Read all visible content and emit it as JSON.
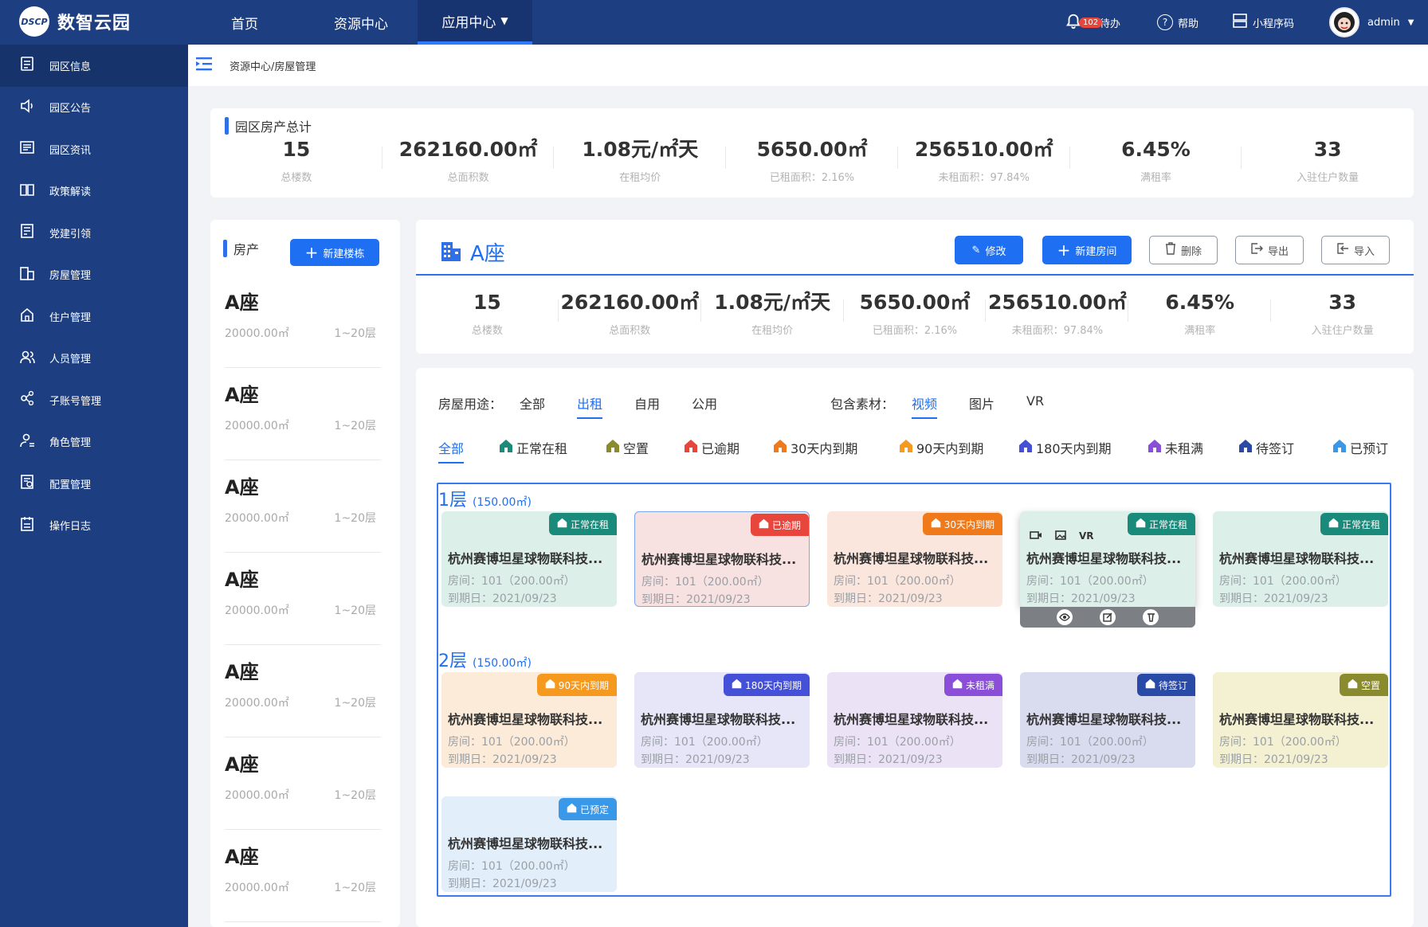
{
  "app": {
    "logo_text": "DSCP",
    "name": "数智云园"
  },
  "topnav": [
    {
      "label": "首页"
    },
    {
      "label": "资源中心"
    },
    {
      "label": "应用中心"
    }
  ],
  "topright": {
    "todo_badge": "102",
    "todo": "待办",
    "help": "帮助",
    "miniapp": "小程序码",
    "user": "admin"
  },
  "sidebar": {
    "items": [
      {
        "label": "园区信息",
        "icon": "document-icon"
      },
      {
        "label": "园区公告",
        "icon": "speaker-icon"
      },
      {
        "label": "园区资讯",
        "icon": "news-icon"
      },
      {
        "label": "政策解读",
        "icon": "book-icon"
      },
      {
        "label": "党建引领",
        "icon": "flag-icon"
      },
      {
        "label": "房屋管理",
        "icon": "building-icon"
      },
      {
        "label": "住户管理",
        "icon": "house-icon"
      },
      {
        "label": "人员管理",
        "icon": "users-icon"
      },
      {
        "label": "子账号管理",
        "icon": "sub-account-icon"
      },
      {
        "label": "角色管理",
        "icon": "role-icon"
      },
      {
        "label": "配置管理",
        "icon": "config-icon"
      },
      {
        "label": "操作日志",
        "icon": "log-icon"
      }
    ]
  },
  "breadcrumb": "资源中心/房屋管理",
  "summary": {
    "title": "园区房产总计",
    "stats": [
      {
        "value": "15",
        "label": "总楼数"
      },
      {
        "value": "262160.00㎡",
        "label": "总面积数"
      },
      {
        "value": "1.08元/㎡天",
        "label": "在租均价"
      },
      {
        "value": "5650.00㎡",
        "label": "已租面积：2.16%"
      },
      {
        "value": "256510.00㎡",
        "label": "未租面积：97.84%"
      },
      {
        "value": "6.45%",
        "label": "满租率"
      },
      {
        "value": "33",
        "label": "入驻住户数量"
      }
    ]
  },
  "buildings": {
    "title": "房产",
    "new_button": "新建楼栋",
    "list": [
      {
        "name": "A座",
        "area": "20000.00㎡",
        "floors": "1~20层"
      },
      {
        "name": "A座",
        "area": "20000.00㎡",
        "floors": "1~20层"
      },
      {
        "name": "A座",
        "area": "20000.00㎡",
        "floors": "1~20层"
      },
      {
        "name": "A座",
        "area": "20000.00㎡",
        "floors": "1~20层"
      },
      {
        "name": "A座",
        "area": "20000.00㎡",
        "floors": "1~20层"
      },
      {
        "name": "A座",
        "area": "20000.00㎡",
        "floors": "1~20层"
      },
      {
        "name": "A座",
        "area": "20000.00㎡",
        "floors": "1~20层"
      }
    ]
  },
  "detail": {
    "title": "A座",
    "buttons": {
      "edit": "修改",
      "new_room": "新建房间",
      "delete": "删除",
      "export": "导出",
      "import": "导入"
    },
    "stats": [
      {
        "value": "15",
        "label": "总楼数"
      },
      {
        "value": "262160.00㎡",
        "label": "总面积数"
      },
      {
        "value": "1.08元/㎡天",
        "label": "在租均价"
      },
      {
        "value": "5650.00㎡",
        "label": "已租面积：2.16%"
      },
      {
        "value": "256510.00㎡",
        "label": "未租面积：97.84%"
      },
      {
        "value": "6.45%",
        "label": "满租率"
      },
      {
        "value": "33",
        "label": "入驻住户数量"
      }
    ]
  },
  "filters": {
    "usage_label": "房屋用途：",
    "usage": [
      "全部",
      "出租",
      "自用",
      "公用"
    ],
    "usage_selected": 1,
    "material_label": "包含素材：",
    "material": [
      "视频",
      "图片",
      "VR"
    ],
    "material_selected": 0
  },
  "status_filters": {
    "all": "全部",
    "items": [
      {
        "label": "正常在租",
        "color": "#1a8a7a"
      },
      {
        "label": "空置",
        "color": "#8a8a2e"
      },
      {
        "label": "已逾期",
        "color": "#e8453c"
      },
      {
        "label": "30天内到期",
        "color": "#f07a1a"
      },
      {
        "label": "90天内到期",
        "color": "#f59a1e"
      },
      {
        "label": "180天内到期",
        "color": "#4450d8"
      },
      {
        "label": "未租满",
        "color": "#8a4ed8"
      },
      {
        "label": "待签订",
        "color": "#2a4aa8"
      },
      {
        "label": "已预订",
        "color": "#3a98e8"
      }
    ]
  },
  "floors": [
    {
      "name": "1层",
      "area": "(150.00㎡)"
    },
    {
      "name": "2层",
      "area": "(150.00㎡)"
    }
  ],
  "room_text": {
    "title": "杭州赛博坦星球物联科技...",
    "room": "房间：101（200.00㎡）",
    "due": "到期日：2021/09/23"
  },
  "rooms": [
    {
      "status": "正常在租",
      "tag_color": "#1a8a7a",
      "bg": "#dcefe9"
    },
    {
      "status": "已逾期",
      "tag_color": "#e8453c",
      "bg": "#f8e1e1"
    },
    {
      "status": "30天内到期",
      "tag_color": "#f07a1a",
      "bg": "#fae6dc"
    },
    {
      "status": "正常在租",
      "tag_color": "#1a8a7a",
      "bg": "#dcefe9"
    },
    {
      "status": "正常在租",
      "tag_color": "#1a8a7a",
      "bg": "#dcefe9"
    },
    {
      "status": "90天内到期",
      "tag_color": "#f59a1e",
      "bg": "#fcebd8"
    },
    {
      "status": "180天内到期",
      "tag_color": "#4450d8",
      "bg": "#e6e6f8"
    },
    {
      "status": "未租满",
      "tag_color": "#8a4ed8",
      "bg": "#ece2f6"
    },
    {
      "status": "待签订",
      "tag_color": "#2a4aa8",
      "bg": "#d9dcef"
    },
    {
      "status": "空置",
      "tag_color": "#8a8a2e",
      "bg": "#f4f0d2"
    },
    {
      "status": "已预定",
      "tag_color": "#3a98e8",
      "bg": "#e2eefa"
    }
  ],
  "hover_room": {
    "icons": [
      "video-icon",
      "image-icon",
      "VR"
    ]
  }
}
